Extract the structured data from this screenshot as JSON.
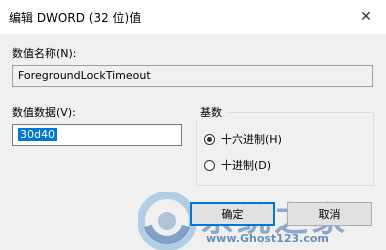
{
  "window": {
    "title": "编辑 DWORD (32 位)值",
    "close_glyph": "✕"
  },
  "value_name": {
    "label": "数值名称(N):",
    "value": "ForegroundLockTimeout"
  },
  "value_data": {
    "label": "数值数据(V):",
    "value": "30d40"
  },
  "base": {
    "title": "基数",
    "options": [
      {
        "label": "十六进制(H)",
        "checked": true
      },
      {
        "label": "十进制(D)",
        "checked": false
      }
    ]
  },
  "buttons": {
    "ok": "确定",
    "cancel": "取消"
  },
  "watermark": {
    "title": "系统之家",
    "url": "www.Ghost123.com",
    "colors": {
      "primary": "#3c6eaa",
      "secondary": "#7fb2dd"
    }
  },
  "colors": {
    "accent": "#0078d7",
    "dialog_bg": "#f0f0f0",
    "titlebar_bg": "#ffffff"
  }
}
